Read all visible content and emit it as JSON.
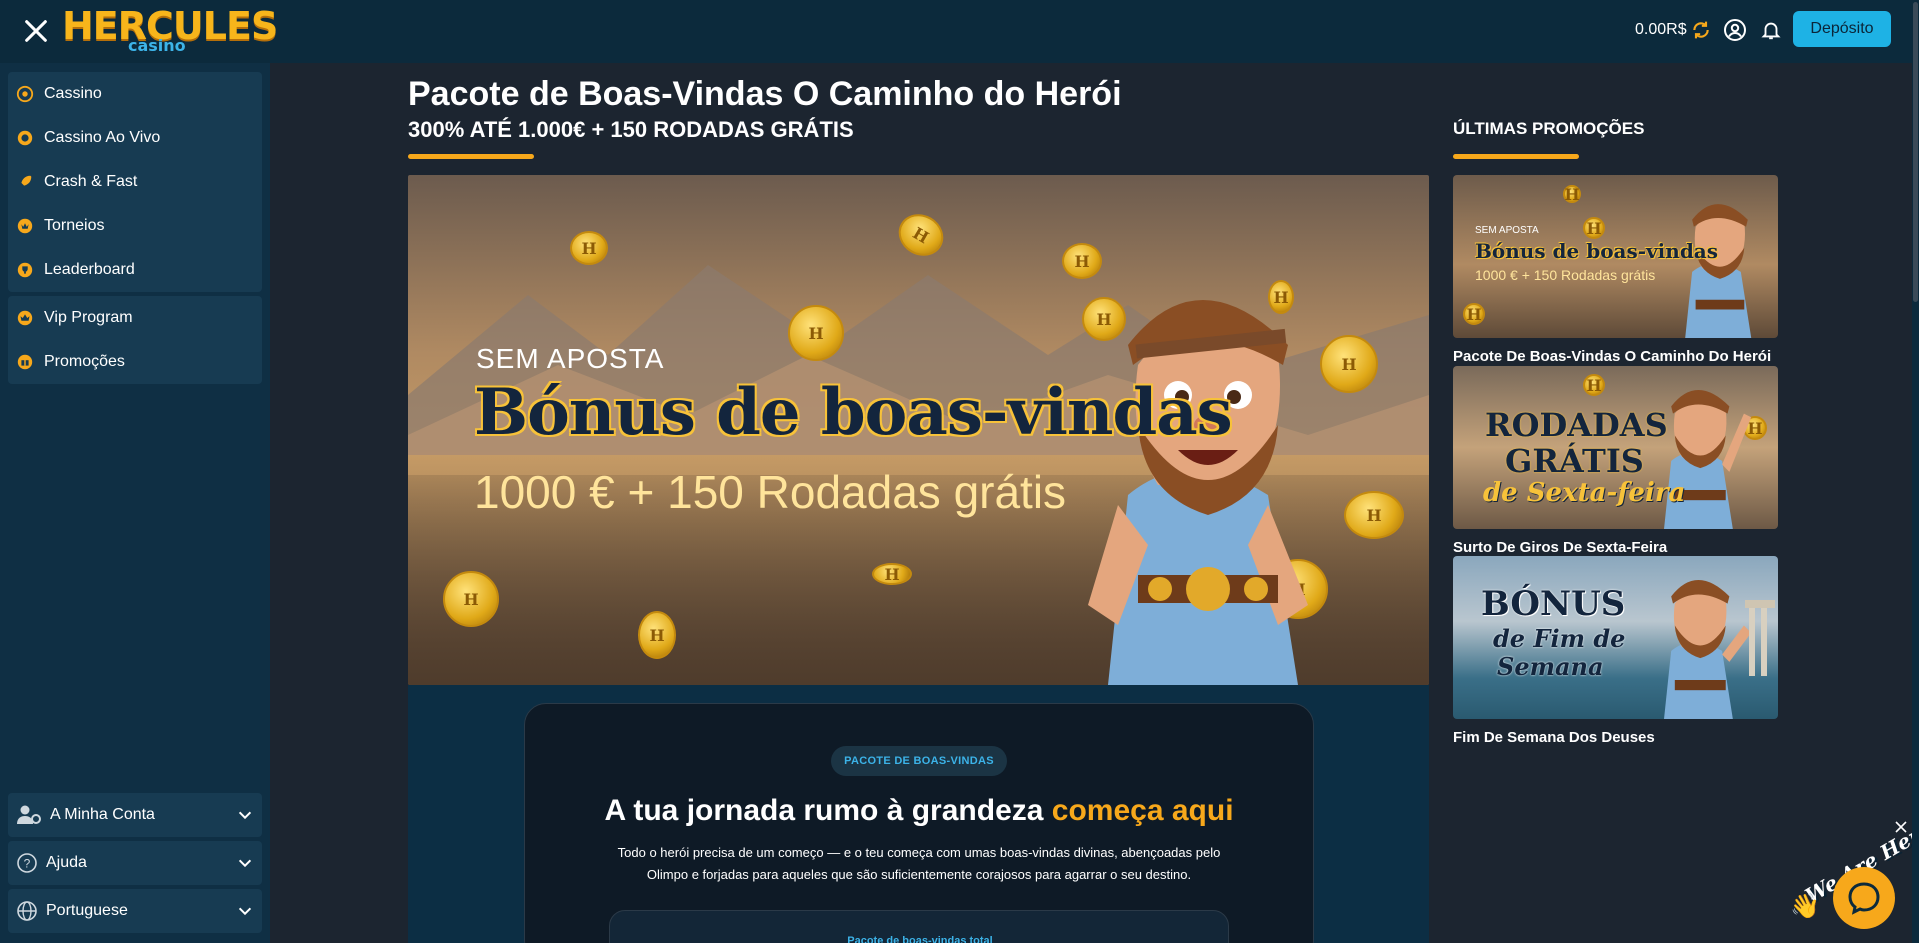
{
  "header": {
    "logo_main": "HERCULES",
    "logo_sub": "casino",
    "balance": "0.00R$",
    "deposit_label": "Depósito"
  },
  "sidebar": {
    "group1": [
      {
        "label": "Cassino",
        "icon": "cassino-icon"
      },
      {
        "label": "Cassino Ao Vivo",
        "icon": "live-casino-icon"
      },
      {
        "label": "Crash & Fast",
        "icon": "rocket-icon"
      },
      {
        "label": "Torneios",
        "icon": "tournament-icon"
      },
      {
        "label": "Leaderboard",
        "icon": "trophy-icon"
      }
    ],
    "group2": [
      {
        "label": "Vip Program",
        "icon": "crown-icon"
      },
      {
        "label": "Promoções",
        "icon": "gift-icon"
      }
    ],
    "bottom": [
      {
        "label": "A Minha Conta",
        "icon": "account-settings-icon"
      },
      {
        "label": "Ajuda",
        "icon": "help-icon"
      },
      {
        "label": "Portuguese",
        "icon": "globe-icon"
      }
    ]
  },
  "main": {
    "title": "Pacote de Boas-Vindas O Caminho do Herói",
    "subtitle": "300% ATÉ 1.000€ + 150 RODADAS GRÁTIS",
    "hero": {
      "tag": "SEM APOSTA",
      "headline": "Bónus de boas-vindas",
      "amount": "1000 € + 150 Rodadas grátis"
    },
    "info": {
      "pill": "PACOTE DE BOAS-VINDAS",
      "heading_start": "A tua jornada rumo à grandeza ",
      "heading_accent": "começa aqui",
      "text": "Todo o herói precisa de um começo — e o teu começa com umas boas-vindas divinas, abençoadas pelo Olimpo e forjadas para aqueles que são suficientemente corajosos para agarrar o seu destino.",
      "inner_label": "Pacote de boas-vindas total"
    }
  },
  "promotions": {
    "title": "ÚLTIMAS PROMOÇÕES",
    "items": [
      {
        "label": "Pacote De Boas-Vindas O Caminho Do Herói",
        "img_tag": "SEM APOSTA",
        "img_line1": "Bónus de boas-vindas",
        "img_line2": "1000 € + 150 Rodadas grátis"
      },
      {
        "label": "Surto De Giros De Sexta-Feira",
        "img_line1": "RODADAS",
        "img_line2": "GRÁTIS",
        "img_line3": "de Sexta-feira"
      },
      {
        "label": "Fim De Semana Dos Deuses",
        "img_line1": "BÓNUS",
        "img_line2": "de Fim de",
        "img_line3": "Semana"
      }
    ]
  },
  "chat": {
    "text": "We Are Here!"
  },
  "colors": {
    "accent": "#f7a81b",
    "brand_blue": "#1eb2e5",
    "header_bg": "#0c2a3c",
    "sidebar_bg": "#0f2f44",
    "main_bg": "#1c2530"
  }
}
